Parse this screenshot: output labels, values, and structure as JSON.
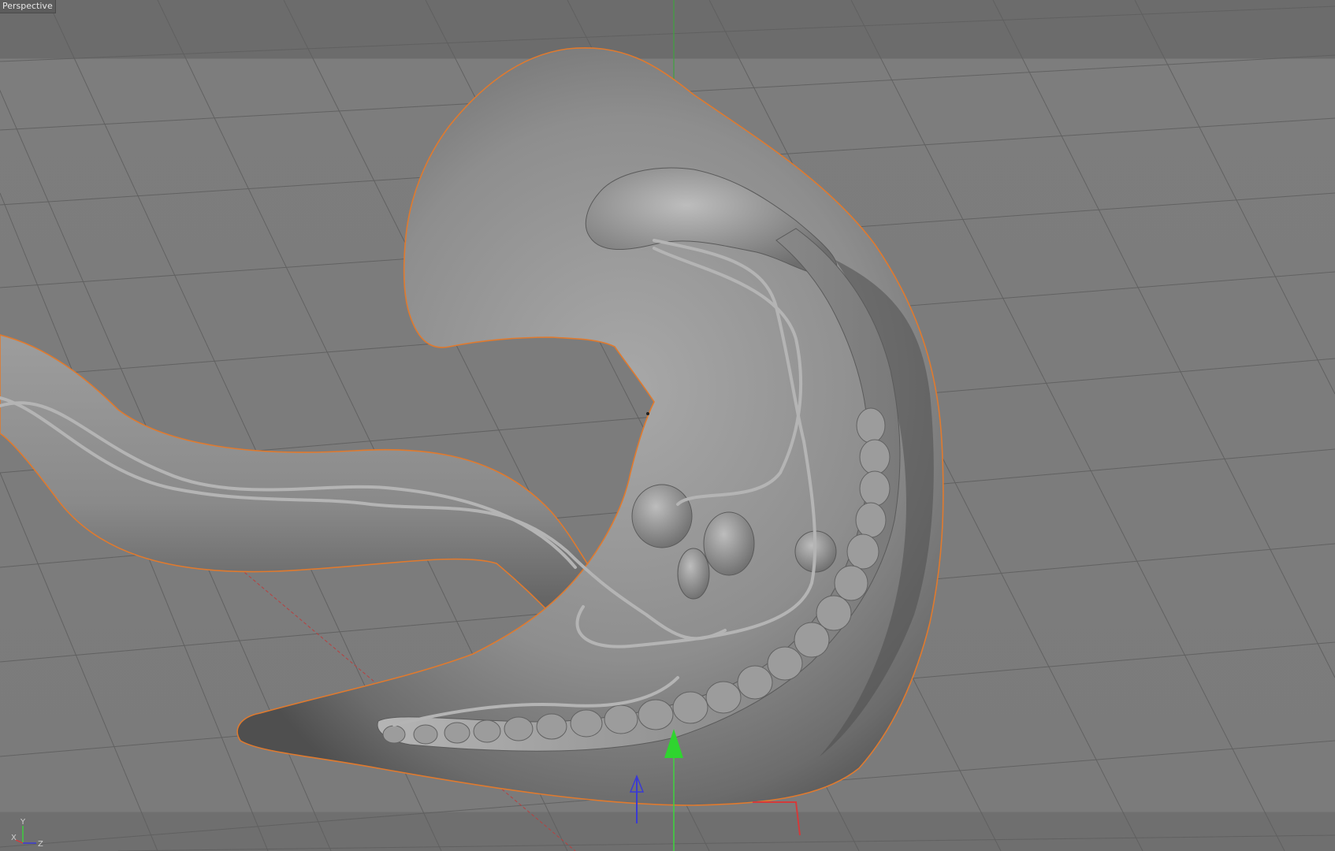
{
  "viewport": {
    "label": "Perspective",
    "background": "#7b7b7b",
    "grid_color": "#5f5f5f",
    "selection_outline_color": "#e07a2e"
  },
  "gizmo": {
    "x_axis_label": "X",
    "y_axis_label": "Y",
    "z_axis_label": "Z",
    "x_color": "#d43a3a",
    "y_color": "#3ad43a",
    "z_color": "#3a3ad4"
  },
  "icons": {
    "move_y_handle": "arrow-up-icon",
    "move_x_handle": "arrow-right-icon",
    "move_z_handle": "arrow-depth-icon"
  }
}
